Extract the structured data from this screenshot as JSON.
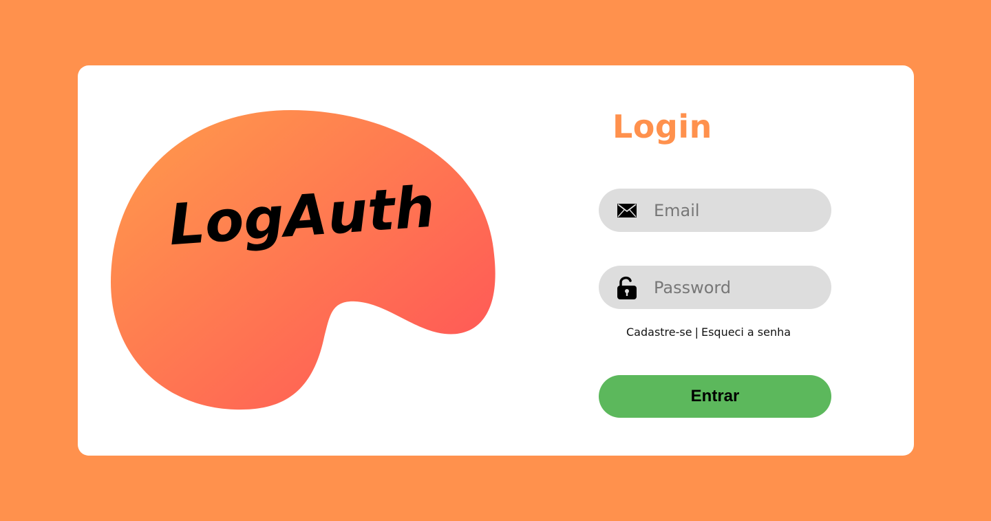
{
  "brand": {
    "logo_text": "LogAuth",
    "background_color": "#FF914D",
    "blob_gradient_start": "#FF914D",
    "blob_gradient_end": "#FF5757"
  },
  "login": {
    "title": "Login",
    "title_color": "#FF914D",
    "email": {
      "placeholder": "Email",
      "value": "",
      "icon": "envelope-icon"
    },
    "password": {
      "placeholder": "Password",
      "value": "",
      "icon": "unlocked-padlock-icon"
    },
    "links": {
      "signup_label": "Cadastre-se",
      "separator": "|",
      "forgot_label": "Esqueci a senha"
    },
    "submit": {
      "label": "Entrar",
      "color": "#5CB85C"
    }
  }
}
